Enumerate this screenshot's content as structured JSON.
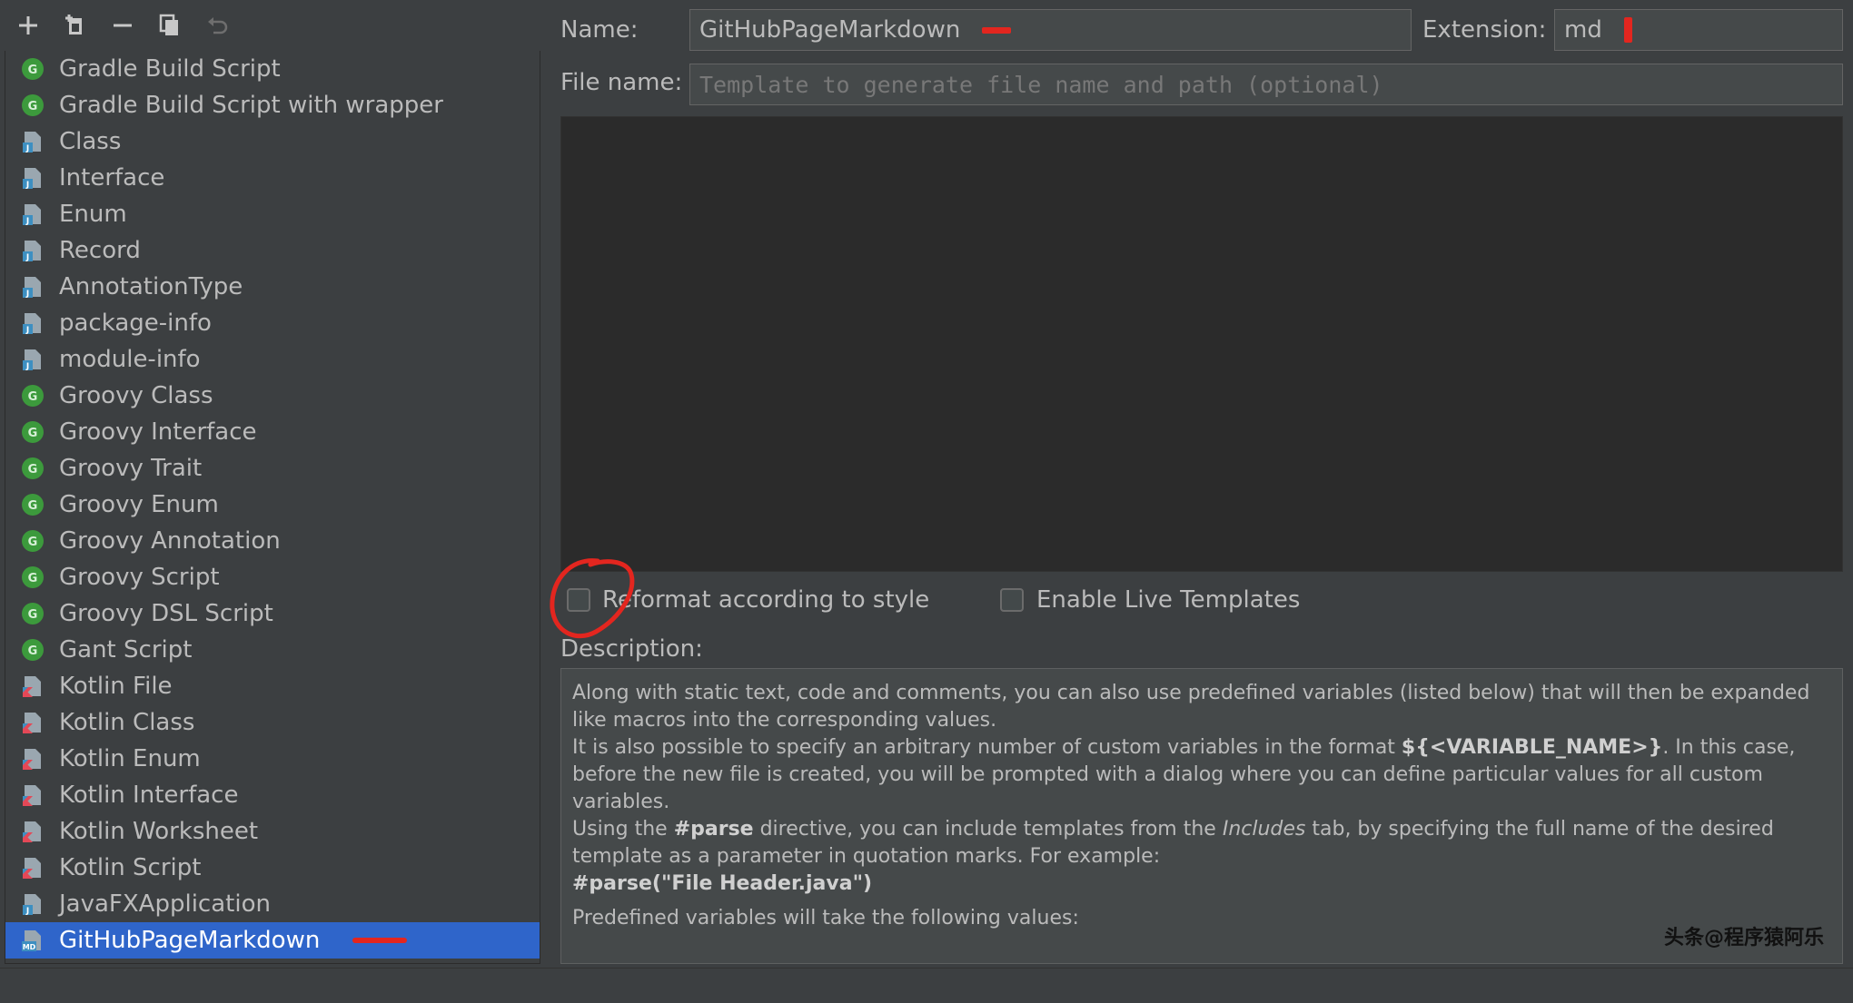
{
  "toolbar": {
    "buttons": [
      {
        "name": "add-template-button",
        "icon": "plus-icon"
      },
      {
        "name": "add-child-button",
        "icon": "add-file-icon"
      },
      {
        "name": "remove-template-button",
        "icon": "minus-icon"
      },
      {
        "name": "copy-template-button",
        "icon": "copy-icon"
      },
      {
        "name": "reset-template-button",
        "icon": "undo-icon"
      }
    ]
  },
  "templates": [
    {
      "label": "Gradle Build Script",
      "icon": "groovy"
    },
    {
      "label": "Gradle Build Script with wrapper",
      "icon": "groovy"
    },
    {
      "label": "Class",
      "icon": "java"
    },
    {
      "label": "Interface",
      "icon": "java"
    },
    {
      "label": "Enum",
      "icon": "java"
    },
    {
      "label": "Record",
      "icon": "java"
    },
    {
      "label": "AnnotationType",
      "icon": "java"
    },
    {
      "label": "package-info",
      "icon": "java"
    },
    {
      "label": "module-info",
      "icon": "java"
    },
    {
      "label": "Groovy Class",
      "icon": "groovy"
    },
    {
      "label": "Groovy Interface",
      "icon": "groovy"
    },
    {
      "label": "Groovy Trait",
      "icon": "groovy"
    },
    {
      "label": "Groovy Enum",
      "icon": "groovy"
    },
    {
      "label": "Groovy Annotation",
      "icon": "groovy"
    },
    {
      "label": "Groovy Script",
      "icon": "groovy"
    },
    {
      "label": "Groovy DSL Script",
      "icon": "groovy"
    },
    {
      "label": "Gant Script",
      "icon": "groovy"
    },
    {
      "label": "Kotlin File",
      "icon": "kotlin"
    },
    {
      "label": "Kotlin Class",
      "icon": "kotlin"
    },
    {
      "label": "Kotlin Enum",
      "icon": "kotlin"
    },
    {
      "label": "Kotlin Interface",
      "icon": "kotlin"
    },
    {
      "label": "Kotlin Worksheet",
      "icon": "kotlin"
    },
    {
      "label": "Kotlin Script",
      "icon": "kotlin"
    },
    {
      "label": "JavaFXApplication",
      "icon": "java"
    },
    {
      "label": "GitHubPageMarkdown",
      "icon": "markdown",
      "selected": true
    }
  ],
  "form": {
    "name_label": "Name:",
    "name_value": "GitHubPageMarkdown",
    "extension_label": "Extension:",
    "extension_value": "md",
    "filename_label": "File name:",
    "filename_placeholder": "Template to generate file name and path (optional)",
    "reformat_label": "Reformat according to style",
    "live_templates_label": "Enable Live Templates",
    "description_label": "Description:"
  },
  "description": {
    "p1": "Along with static text, code and comments, you can also use predefined variables (listed below) that will then be expanded like macros into the corresponding values.",
    "p2_a": "It is also possible to specify an arbitrary number of custom variables in the format ",
    "p2_b": "${<VARIABLE_NAME>}",
    "p2_c": ". In this case, before the new file is created, you will be prompted with a dialog where you can define particular values for all custom variables.",
    "p3_a": "Using the ",
    "p3_b": "#parse",
    "p3_c": " directive, you can include templates from the ",
    "p3_d": "Includes",
    "p3_e": " tab, by specifying the full name of the desired template as a parameter in quotation marks. For example:",
    "p4": "#parse(\"File Header.java\")",
    "p5": "Predefined variables will take the following values:"
  },
  "watermark": "头条@程序猿阿乐",
  "colors": {
    "selection": "#2f65ca",
    "groovy": "#3c9a3c",
    "java": "#3d8fc1",
    "annotation": "#e3261f"
  }
}
